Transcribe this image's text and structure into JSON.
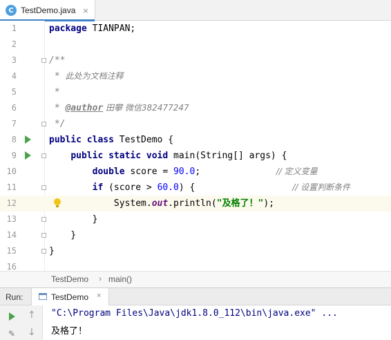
{
  "editor_tab": {
    "icon_letter": "C",
    "title": "TestDemo.java",
    "close": "×"
  },
  "code_lines": {
    "l1": {
      "n": "1",
      "kw": "package",
      "rest": " TIANPAN;"
    },
    "l2": {
      "n": "2"
    },
    "l3": {
      "n": "3",
      "text": "/**"
    },
    "l4": {
      "n": "4",
      "star": " * ",
      "text": "此处为文档注释"
    },
    "l5": {
      "n": "5",
      "text": " *"
    },
    "l6": {
      "n": "6",
      "star": " * ",
      "tag": "@author",
      "text": " 田攀 微信382477247"
    },
    "l7": {
      "n": "7",
      "text": " */"
    },
    "l8": {
      "n": "8",
      "kw": "public class",
      "rest": " TestDemo {"
    },
    "l9": {
      "n": "9",
      "indent": "    ",
      "kw": "public static void",
      "rest": " main(String[] args) {"
    },
    "l10": {
      "n": "10",
      "indent": "        ",
      "kw": "double",
      "a": " score = ",
      "num": "90.0",
      "b": ";",
      "pad": "              ",
      "cm": "// 定义变量"
    },
    "l11": {
      "n": "11",
      "indent": "        ",
      "kw": "if",
      "a": " (score > ",
      "num": "60.0",
      "b": ") {",
      "pad": "                  ",
      "cm": "// 设置判断条件"
    },
    "l12": {
      "n": "12",
      "indent": "            ",
      "a": "System.",
      "field": "out",
      "b": ".println(",
      "str": "\"及格了！\"",
      "c": ");"
    },
    "l13": {
      "n": "13",
      "text": "        }"
    },
    "l14": {
      "n": "14",
      "text": "    }"
    },
    "l15": {
      "n": "15",
      "text": "}"
    },
    "l16": {
      "n": "16"
    }
  },
  "breadcrumb": {
    "items": [
      "TestDemo",
      "main()"
    ],
    "separator": "›"
  },
  "run_panel": {
    "label": "Run:",
    "tab_title": "TestDemo",
    "tab_close": "×",
    "command": "\"C:\\Program Files\\Java\\jdk1.8.0_112\\bin\\java.exe\" ...",
    "output": "及格了！"
  },
  "icons": {
    "run_gutter": "run-arrow-icon",
    "fold": "fold-marker-icon",
    "intention": "lightbulb-icon",
    "rerun": "rerun-icon",
    "up": "up-arrow-icon",
    "down": "down-arrow-icon",
    "wrench": "wrench-icon"
  },
  "colors": {
    "keyword": "#000080",
    "number": "#0000ff",
    "string": "#008000",
    "comment": "#808080",
    "static_field": "#660e7a",
    "current_line": "#fcfaed",
    "tab_accent": "#4083c9",
    "run_green": "#4aa34a"
  }
}
